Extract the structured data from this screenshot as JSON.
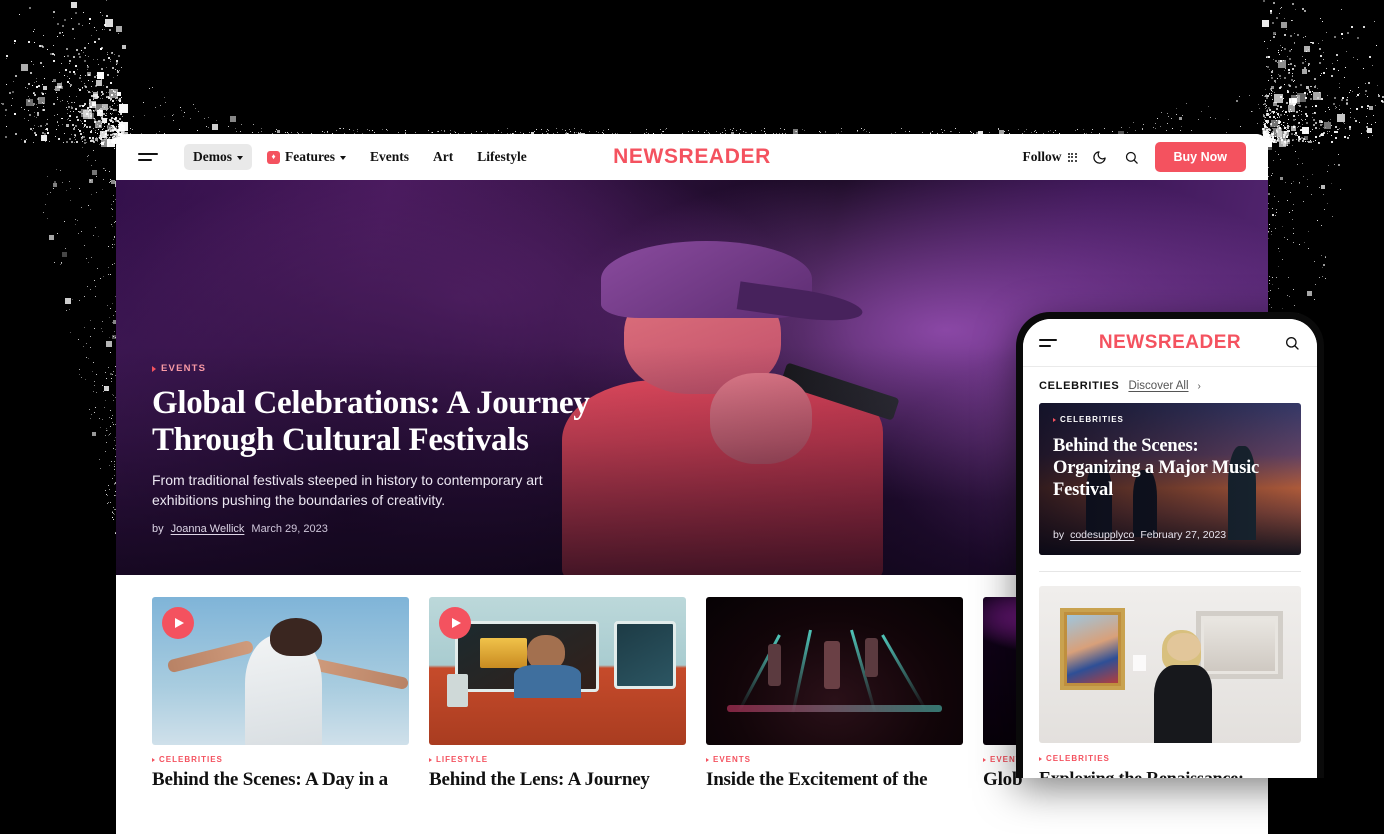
{
  "brand": {
    "logo": "NEWSREADER",
    "accent": "#f4525f"
  },
  "desktop": {
    "nav": {
      "menu_icon": "hamburger-icon",
      "items": [
        {
          "label": "Demos",
          "has_caret": true,
          "active": true,
          "badge": false
        },
        {
          "label": "Features",
          "has_caret": true,
          "active": false,
          "badge": true
        },
        {
          "label": "Events",
          "has_caret": false,
          "active": false,
          "badge": false
        },
        {
          "label": "Art",
          "has_caret": false,
          "active": false,
          "badge": false
        },
        {
          "label": "Lifestyle",
          "has_caret": false,
          "active": false,
          "badge": false
        }
      ],
      "follow_label": "Follow",
      "grid_icon": "grid-dots-icon",
      "theme_icon": "moon-icon",
      "search_icon": "search-icon",
      "cta_label": "Buy Now"
    },
    "hero": {
      "kicker": "EVENTS",
      "title": "Global Celebrations: A Journey Through Cultural Festivals",
      "subtitle": "From traditional festivals steeped in history to contemporary art exhibitions pushing the boundaries of creativity.",
      "by_prefix": "by",
      "author": "Joanna Wellick",
      "date": "March 29, 2023"
    },
    "cards": [
      {
        "kicker": "CELEBRITIES",
        "title": "Behind the Scenes: A Day in a",
        "has_play": true,
        "art": "t-sky"
      },
      {
        "kicker": "LIFESTYLE",
        "title": "Behind the Lens: A Journey",
        "has_play": true,
        "art": "t-van"
      },
      {
        "kicker": "EVENTS",
        "title": "Inside the Excitement of the",
        "has_play": false,
        "art": "t-stage"
      },
      {
        "kicker": "EVENTS",
        "title": "Glob",
        "has_play": false,
        "art": "t-purple"
      }
    ]
  },
  "mobile": {
    "nav": {
      "menu_icon": "hamburger-icon",
      "logo": "NEWSREADER",
      "search_icon": "search-icon"
    },
    "discover": {
      "category": "CELEBRITIES",
      "link": "Discover All",
      "chevron": "›"
    },
    "featured": {
      "kicker": "CELEBRITIES",
      "title": "Behind the Scenes: Organizing a Major Music Festival",
      "by_prefix": "by",
      "author": "codesupplyco",
      "date": "February 27, 2023"
    },
    "article": {
      "kicker": "CELEBRITIES",
      "title": "Exploring the Renaissance: Masters and Masterpieces"
    }
  }
}
